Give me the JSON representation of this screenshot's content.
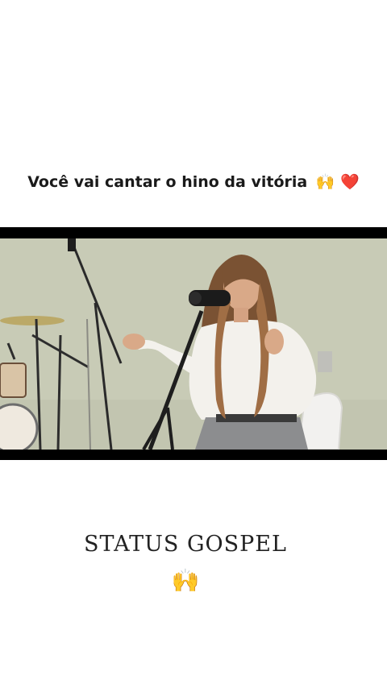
{
  "post": {
    "caption": "Você vai cantar o hino da vitória",
    "caption_emojis": "🙌 ❤️",
    "watermark": "STATUS GOSPEL",
    "watermark_emoji": "🙌"
  },
  "video": {
    "scene_description_icon": "singer-performance-video",
    "colors": {
      "background": "#c7cab5",
      "letterbox": "#000000",
      "shirt": "#f3f1ec",
      "trousers": "#8c8d8f",
      "hair": "#7a5233"
    }
  }
}
